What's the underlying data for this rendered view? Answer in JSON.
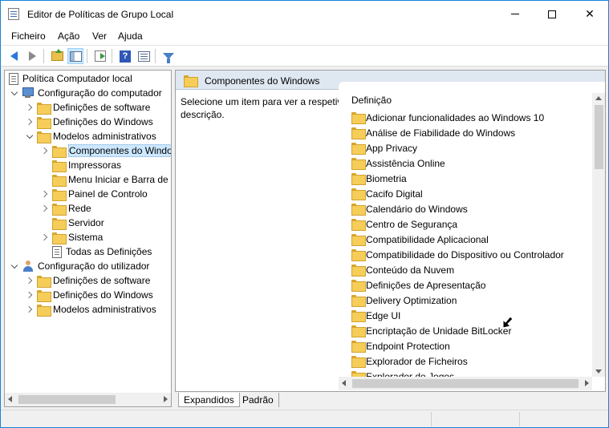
{
  "window": {
    "title": "Editor de Políticas de Grupo Local",
    "controls": {
      "minimize": "—",
      "maximize": "☐",
      "close": "✕"
    }
  },
  "menu": [
    "Ficheiro",
    "Ação",
    "Ver",
    "Ajuda"
  ],
  "toolbar": {
    "icons": [
      "back-arrow-icon",
      "forward-arrow-icon",
      "folder-up-icon",
      "show-hide-tree-icon",
      "export-list-icon",
      "help-icon",
      "properties-view-icon",
      "filter-icon"
    ]
  },
  "tree": {
    "root": "Política Computador local",
    "items": [
      {
        "label": "Configuração do computador"
      },
      {
        "label": "Definições de software"
      },
      {
        "label": "Definições do Windows"
      },
      {
        "label": "Modelos administrativos"
      },
      {
        "label": "Componentes do Windows"
      },
      {
        "label": "Impressoras"
      },
      {
        "label": "Menu Iniciar e Barra de"
      },
      {
        "label": "Painel de Controlo"
      },
      {
        "label": "Rede"
      },
      {
        "label": "Servidor"
      },
      {
        "label": "Sistema"
      },
      {
        "label": "Todas as Definições"
      },
      {
        "label": "Configuração do utilizador"
      },
      {
        "label": "Definições de software"
      },
      {
        "label": "Definições do Windows"
      },
      {
        "label": "Modelos administrativos"
      }
    ]
  },
  "content": {
    "header_title": "Componentes do Windows",
    "description_line1": "Selecione um item para ver a respetiva",
    "description_line2": "descrição.",
    "column_header": "Definição",
    "items": [
      "Adicionar funcionalidades ao Windows 10",
      "Análise de Fiabilidade do Windows",
      "App Privacy",
      "Assistência Online",
      "Biometria",
      "Cacifo Digital",
      "Calendário do Windows",
      "Centro de Segurança",
      "Compatibilidade Aplicacional",
      "Compatibilidade do Dispositivo ou Controlador",
      "Conteúdo da Nuvem",
      "Definições de Apresentação",
      "Delivery Optimization",
      "Edge UI",
      "Encriptação de Unidade BitLocker",
      "Endpoint Protection",
      "Explorador de Ficheiros",
      "Explorador de Jogos"
    ]
  },
  "tabs": [
    "Expandidos",
    "Padrão"
  ]
}
